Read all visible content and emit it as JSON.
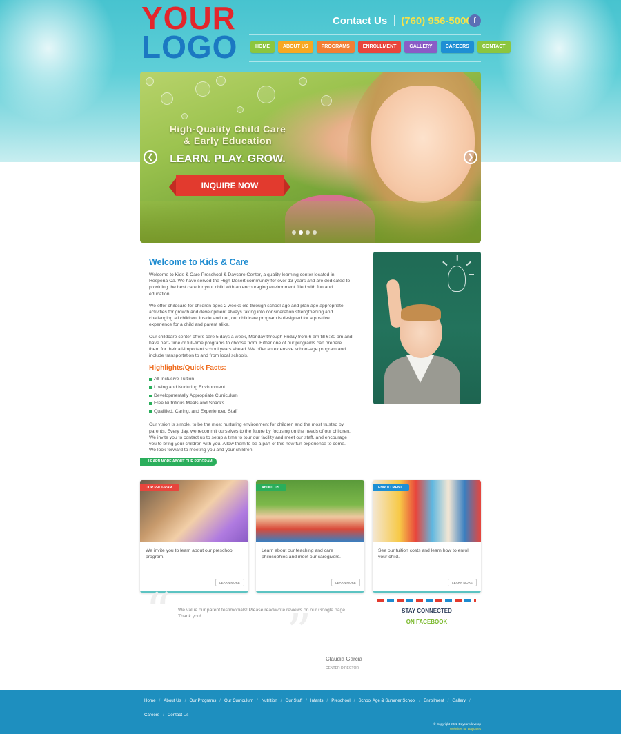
{
  "logo": {
    "line1": "YOUR",
    "line2": "LOGO"
  },
  "header": {
    "contact_label": "Contact Us",
    "phone": "(760) 956-5000",
    "facebook_glyph": "f"
  },
  "nav": [
    {
      "label": "HOME",
      "color": "#8cc63f"
    },
    {
      "label": "ABOUT US",
      "color": "#f7a823"
    },
    {
      "label": "PROGRAMS",
      "color": "#f37f34"
    },
    {
      "label": "ENROLLMENT",
      "color": "#e8453c"
    },
    {
      "label": "GALLERY",
      "color": "#8a5cc6"
    },
    {
      "label": "CAREERS",
      "color": "#1e8fd4"
    },
    {
      "label": "CONTACT",
      "color": "#8cc63f"
    }
  ],
  "hero": {
    "tagline_line1": "High-Quality Child Care",
    "tagline_line2": "& Early Education",
    "motto": "LEARN. PLAY. GROW.",
    "cta": "INQUIRE NOW",
    "prev_glyph": "❮",
    "next_glyph": "❯",
    "slide_count": 4,
    "active_slide": 1
  },
  "welcome": {
    "title": "Welcome to Kids & Care",
    "p1": "Welcome to Kids & Care Preschool & Daycare Center, a quality learning center located in Hesperia Ca. We have served the High Desert community for over 13 years and are dedicated to providing the best care for your child with an encouraging environment filled with fun and education.",
    "p2": "We offer childcare for children ages 2 weeks old through school age and plan age appropriate activities for growth and development always taking into consideration strengthening and challenging all children. Inside and out, our childcare program is designed for a positive experience for a child and parent alike.",
    "p3": "Our childcare center offers care 5 days a week, Monday through Friday from 6 am till 6:30 pm and have part- time or full-time programs to choose from. Either one of our programs can prepare them for their all-important school years ahead. We offer an extensive school-age program and include transportation to and from local schools.",
    "highlights_title": "Highlights/Quick Facts:",
    "highlights": [
      "All-Inclusive Tuition",
      "Loving and Nurturing Environment",
      "Developmentally Appropriate Curriculum",
      "Free Nutritious Meals and Snacks",
      "Qualified, Caring, and Experienced Staff"
    ],
    "p4": "Our vision is simple, to be the most nurturing environment for children and the most trusted by parents. Every day, we recommit ourselves to the future by focusing on the needs of our children. We invite you to contact us to setup a time to tour our facility and meet our staff, and encourage you to bring your children with you. Allow them to be a part of this new fun experience to come. We look forward to meeting you and your children.",
    "learn_more": "LEARN MORE ABOUT OUR PROGRAM"
  },
  "cards": [
    {
      "tag": "OUR PROGRAM",
      "tag_color": "#e8453c",
      "text": "We invite you to learn about our preschool program.",
      "button": "LEARN MORE"
    },
    {
      "tag": "ABOUT US",
      "tag_color": "#2aae5b",
      "text": "Learn about our teaching and care philosophies and meet our caregivers.",
      "button": "LEARN MORE"
    },
    {
      "tag": "ENROLLMENT",
      "tag_color": "#1e8fd4",
      "text": "See our tuition costs and learn how to enroll your child.",
      "button": "LEARN MORE"
    }
  ],
  "testimonial": {
    "text": "We value our parent testimonials! Please read/write reviews on our Google page. Thank you!",
    "author": "Claudia Garcia",
    "author_title": "CENTER DIRECTOR"
  },
  "social": {
    "line1": "STAY CONNECTED",
    "line2": "ON FACEBOOK"
  },
  "footer": {
    "links": [
      "Home",
      "About Us",
      "Our Programs",
      "Our Curriculum",
      "Nutrition",
      "Our Staff",
      "Infants",
      "Preschool",
      "School Age & Summer School",
      "Enrollment",
      "Gallery",
      "Careers",
      "Contact Us"
    ],
    "copyright": "© Copyright 2022 Daycaredevelop",
    "credit": "Websites for Daycares"
  }
}
